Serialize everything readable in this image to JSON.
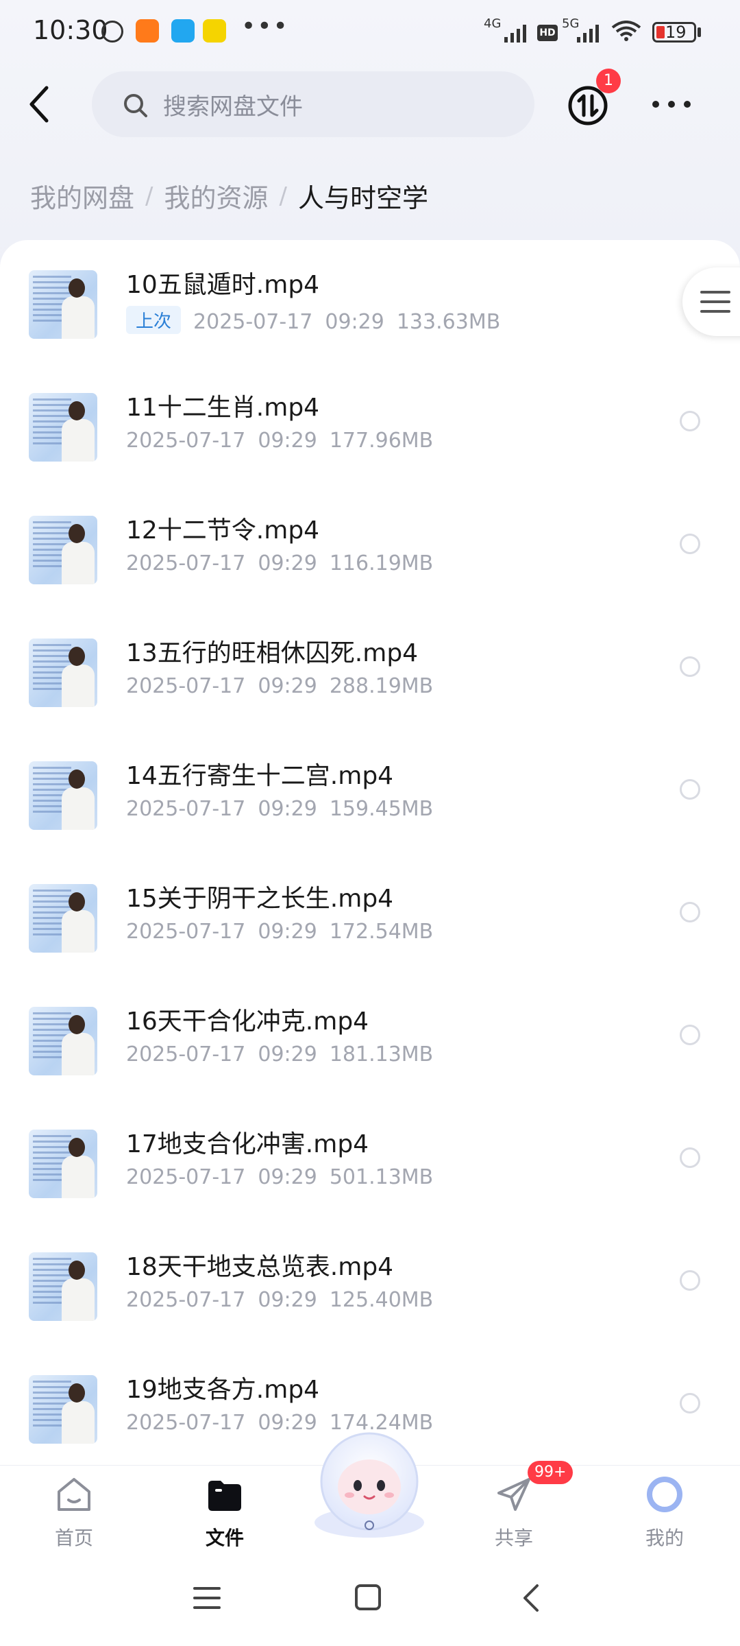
{
  "status_bar": {
    "time": "10:30",
    "network_1": "4G",
    "hd": "HD",
    "network_2": "5G",
    "battery": "19"
  },
  "header": {
    "search_placeholder": "搜索网盘文件",
    "transfer_badge": "1"
  },
  "breadcrumb": [
    {
      "label": "我的网盘"
    },
    {
      "label": "我的资源"
    },
    {
      "label": "人与时空学"
    }
  ],
  "files": [
    {
      "name": "10五鼠遁时.mp4",
      "tag": "上次",
      "date": "2025-07-17",
      "time": "09:29",
      "size": "133.63MB"
    },
    {
      "name": "11十二生肖.mp4",
      "date": "2025-07-17",
      "time": "09:29",
      "size": "177.96MB"
    },
    {
      "name": "12十二节令.mp4",
      "date": "2025-07-17",
      "time": "09:29",
      "size": "116.19MB"
    },
    {
      "name": "13五行的旺相休囚死.mp4",
      "date": "2025-07-17",
      "time": "09:29",
      "size": "288.19MB"
    },
    {
      "name": "14五行寄生十二宫.mp4",
      "date": "2025-07-17",
      "time": "09:29",
      "size": "159.45MB"
    },
    {
      "name": "15关于阴干之长生.mp4",
      "date": "2025-07-17",
      "time": "09:29",
      "size": "172.54MB"
    },
    {
      "name": "16天干合化冲克.mp4",
      "date": "2025-07-17",
      "time": "09:29",
      "size": "181.13MB"
    },
    {
      "name": "17地支合化冲害.mp4",
      "date": "2025-07-17",
      "time": "09:29",
      "size": "501.13MB"
    },
    {
      "name": "18天干地支总览表.mp4",
      "date": "2025-07-17",
      "time": "09:29",
      "size": "125.40MB"
    },
    {
      "name": "19地支各方.mp4",
      "date": "2025-07-17",
      "time": "09:29",
      "size": "174.24MB"
    }
  ],
  "bottom_nav": {
    "home": "首页",
    "files": "文件",
    "share": "共享",
    "share_badge": "99+",
    "mine": "我的"
  },
  "colors": {
    "accent": "#2a7fd6",
    "badge": "#ff3b46"
  }
}
